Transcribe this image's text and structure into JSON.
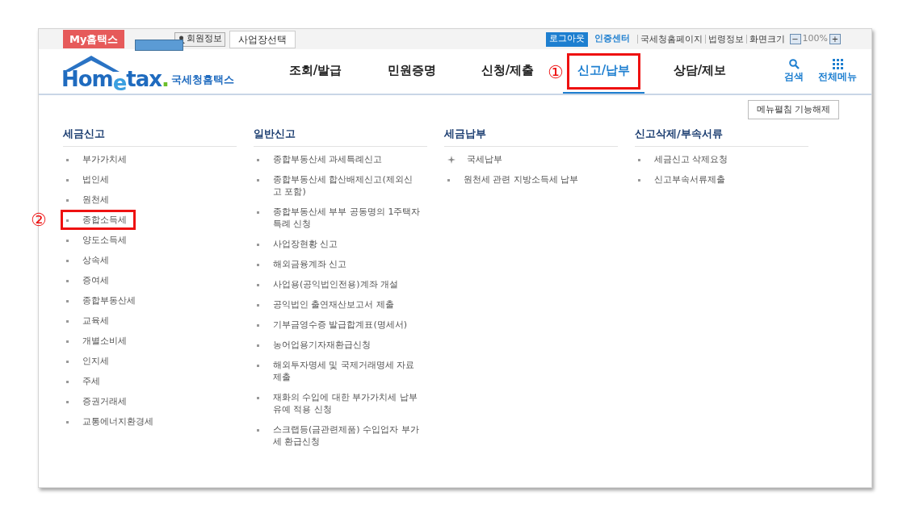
{
  "top_bar": {
    "my_button": "My홈택스",
    "member_button": "회원정보",
    "business_button": "사업장선택",
    "logout_button": "로그아웃",
    "cert_link": "인증센터",
    "links": [
      "국세청홈페이지",
      "법령정보"
    ],
    "zoom": {
      "label": "화면크기",
      "minus": "−",
      "value": "100%",
      "plus": "+"
    }
  },
  "logo": {
    "brand_prefix": "Hom",
    "brand_e": "e",
    "brand_suffix": "tax",
    "brand_dot": ".",
    "name": "국세청홈택스"
  },
  "nav": [
    {
      "label": "조회/발급",
      "selected": false,
      "highlighted": false
    },
    {
      "label": "민원증명",
      "selected": false,
      "highlighted": false
    },
    {
      "label": "신청/제출",
      "selected": false,
      "highlighted": false
    },
    {
      "label": "신고/납부",
      "selected": true,
      "highlighted": true,
      "callout": "①"
    },
    {
      "label": "상담/제보",
      "selected": false,
      "highlighted": false
    }
  ],
  "tools": [
    {
      "kind": "search",
      "label": "검색"
    },
    {
      "kind": "menu",
      "label": "전체메뉴"
    }
  ],
  "menu_toggle_button": "메뉴펼침 기능해제",
  "columns": [
    {
      "title": "세금신고",
      "items": [
        {
          "label": "부가가치세",
          "kind": "dot",
          "highlighted": false
        },
        {
          "label": "법인세",
          "kind": "dot",
          "highlighted": false
        },
        {
          "label": "원천세",
          "kind": "dot",
          "highlighted": false
        },
        {
          "label": "종합소득세",
          "kind": "dot",
          "highlighted": true,
          "callout": "②"
        },
        {
          "label": "양도소득세",
          "kind": "dot",
          "highlighted": false
        },
        {
          "label": "상속세",
          "kind": "dot",
          "highlighted": false
        },
        {
          "label": "증여세",
          "kind": "dot",
          "highlighted": false
        },
        {
          "label": "종합부동산세",
          "kind": "dot",
          "highlighted": false
        },
        {
          "label": "교육세",
          "kind": "dot",
          "highlighted": false
        },
        {
          "label": "개별소비세",
          "kind": "dot",
          "highlighted": false
        },
        {
          "label": "인지세",
          "kind": "dot",
          "highlighted": false
        },
        {
          "label": "주세",
          "kind": "dot",
          "highlighted": false
        },
        {
          "label": "증권거래세",
          "kind": "dot",
          "highlighted": false
        },
        {
          "label": "교통에너지환경세",
          "kind": "dot",
          "highlighted": false
        }
      ]
    },
    {
      "title": "일반신고",
      "items": [
        {
          "label": "종합부동산세 과세특례신고",
          "kind": "dot",
          "highlighted": false
        },
        {
          "label": "종합부동산세 합산배제신고(제외신고 포함)",
          "kind": "dot",
          "highlighted": false
        },
        {
          "label": "종합부동산세 부부 공동명의 1주택자 특례 신청",
          "kind": "dot",
          "highlighted": false
        },
        {
          "label": "사업장현황 신고",
          "kind": "dot",
          "highlighted": false
        },
        {
          "label": "해외금융계좌 신고",
          "kind": "dot",
          "highlighted": false
        },
        {
          "label": "사업용(공익법인전용)계좌 개설",
          "kind": "dot",
          "highlighted": false
        },
        {
          "label": "공익법인 출연재산보고서 제출",
          "kind": "dot",
          "highlighted": false
        },
        {
          "label": "기부금영수증 발급합계표(명세서)",
          "kind": "dot",
          "highlighted": false
        },
        {
          "label": "농어업용기자재환급신청",
          "kind": "dot",
          "highlighted": false
        },
        {
          "label": "해외투자명세 및 국제거래명세 자료 제출",
          "kind": "dot",
          "highlighted": false
        },
        {
          "label": "재화의 수입에 대한 부가가치세 납부 유예 적용 신청",
          "kind": "dot",
          "highlighted": false
        },
        {
          "label": "스크랩등(금관련제품) 수입업자 부가세 환급신청",
          "kind": "dot",
          "highlighted": false
        }
      ]
    },
    {
      "title": "세금납부",
      "items": [
        {
          "label": "국세납부",
          "kind": "star",
          "highlighted": false
        },
        {
          "label": "원천세 관련 지방소득세 납부",
          "kind": "dot",
          "highlighted": false
        }
      ]
    },
    {
      "title": "신고삭제/부속서류",
      "items": [
        {
          "label": "세금신고 삭제요청",
          "kind": "dot",
          "highlighted": false
        },
        {
          "label": "신고부속서류제출",
          "kind": "dot",
          "highlighted": false
        }
      ]
    }
  ]
}
